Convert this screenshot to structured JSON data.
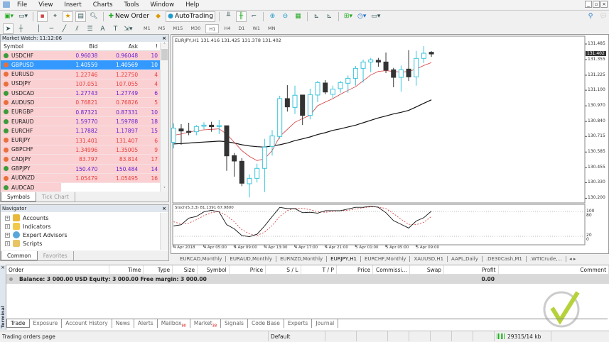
{
  "menu": [
    "File",
    "View",
    "Insert",
    "Charts",
    "Tools",
    "Window",
    "Help"
  ],
  "toolbar": {
    "new_order": "New Order",
    "autotrading": "AutoTrading",
    "timeframes": [
      "M1",
      "M5",
      "M15",
      "M30",
      "H1",
      "H4",
      "D1",
      "W1",
      "MN"
    ],
    "active_tf": "H1"
  },
  "market_watch": {
    "title": "Market Watch: 11:12:06",
    "columns": [
      "Symbol",
      "Bid",
      "Ask",
      "!"
    ],
    "rows": [
      {
        "symbol": "USDCHF",
        "bid": "0.96038",
        "ask": "0.96048",
        "spread": "10",
        "dir": "up"
      },
      {
        "symbol": "GBPUSD",
        "bid": "1.40559",
        "ask": "1.40569",
        "spread": "10",
        "dir": "down",
        "selected": true
      },
      {
        "symbol": "EURUSD",
        "bid": "1.22746",
        "ask": "1.22750",
        "spread": "4",
        "dir": "down"
      },
      {
        "symbol": "USDJPY",
        "bid": "107.051",
        "ask": "107.055",
        "spread": "4",
        "dir": "down"
      },
      {
        "symbol": "USDCAD",
        "bid": "1.27743",
        "ask": "1.27749",
        "spread": "6",
        "dir": "up"
      },
      {
        "symbol": "AUDUSD",
        "bid": "0.76821",
        "ask": "0.76826",
        "spread": "5",
        "dir": "down"
      },
      {
        "symbol": "EURGBP",
        "bid": "0.87321",
        "ask": "0.87331",
        "spread": "10",
        "dir": "up"
      },
      {
        "symbol": "EURAUD",
        "bid": "1.59770",
        "ask": "1.59788",
        "spread": "18",
        "dir": "up"
      },
      {
        "symbol": "EURCHF",
        "bid": "1.17882",
        "ask": "1.17897",
        "spread": "15",
        "dir": "up"
      },
      {
        "symbol": "EURJPY",
        "bid": "131.401",
        "ask": "131.407",
        "spread": "6",
        "dir": "down"
      },
      {
        "symbol": "GBPCHF",
        "bid": "1.34996",
        "ask": "1.35005",
        "spread": "9",
        "dir": "down"
      },
      {
        "symbol": "CADJPY",
        "bid": "83.797",
        "ask": "83.814",
        "spread": "17",
        "dir": "down"
      },
      {
        "symbol": "GBPJPY",
        "bid": "150.470",
        "ask": "150.484",
        "spread": "14",
        "dir": "up"
      },
      {
        "symbol": "AUDNZD",
        "bid": "1.05479",
        "ask": "1.05495",
        "spread": "16",
        "dir": "down"
      },
      {
        "symbol": "AUDCAD",
        "bid": "",
        "ask": "",
        "spread": "",
        "dir": "up"
      }
    ],
    "tabs": [
      "Symbols",
      "Tick Chart"
    ]
  },
  "navigator": {
    "title": "Navigator",
    "items": [
      "Accounts",
      "Indicators",
      "Expert Advisors",
      "Scripts"
    ],
    "tabs": [
      "Common",
      "Favorites"
    ]
  },
  "colors": {
    "up_text": "#6a1fd0",
    "down_text": "#e8403c",
    "bull": "#39c4dc",
    "bear": "#333333",
    "ma_fast": "#d43a3a",
    "ma_slow": "#111111",
    "selected": "#3399ff"
  },
  "chart_data": {
    "type": "candlestick",
    "title": "EURJPY,H1  131.416 131.425 131.378 131.402",
    "current_price": "131.402",
    "y_ticks": [
      "131.485",
      "131.355",
      "131.225",
      "131.100",
      "130.970",
      "130.840",
      "130.715",
      "130.585",
      "130.455",
      "130.330",
      "130.200"
    ],
    "ylim": [
      130.2,
      131.485
    ],
    "candles": [
      [
        130.666,
        130.784,
        130.823,
        130.616
      ],
      [
        130.778,
        130.76,
        130.817,
        130.646
      ],
      [
        130.758,
        130.752,
        130.829,
        130.725
      ],
      [
        130.754,
        130.798,
        130.809,
        130.725
      ],
      [
        130.8,
        130.809,
        130.833,
        130.774
      ],
      [
        130.809,
        130.796,
        130.837,
        130.754
      ],
      [
        130.798,
        130.806,
        130.853,
        130.735
      ],
      [
        130.804,
        130.553,
        130.804,
        130.429
      ],
      [
        130.555,
        130.51,
        130.577,
        130.38
      ],
      [
        130.508,
        130.325,
        130.534,
        130.301
      ],
      [
        130.321,
        130.366,
        130.4,
        130.207
      ],
      [
        130.366,
        130.449,
        130.488,
        130.331
      ],
      [
        130.449,
        130.626,
        130.695,
        130.252
      ],
      [
        130.632,
        130.719,
        130.768,
        130.555
      ],
      [
        130.715,
        131.03,
        131.054,
        130.695
      ],
      [
        131.03,
        130.961,
        131.142,
        130.922
      ],
      [
        130.957,
        131.058,
        131.138,
        130.902
      ],
      [
        131.06,
        130.89,
        131.06,
        130.81
      ],
      [
        130.89,
        131.064,
        131.113,
        130.857
      ],
      [
        131.06,
        131.164,
        131.178,
        131.001
      ],
      [
        131.16,
        131.085,
        131.184,
        131.066
      ],
      [
        131.066,
        131.109,
        131.138,
        131.034
      ],
      [
        131.113,
        131.164,
        131.178,
        131.079
      ],
      [
        131.158,
        131.199,
        131.223,
        131.079
      ],
      [
        131.199,
        131.282,
        131.302,
        131.138
      ],
      [
        131.282,
        131.335,
        131.355,
        131.164
      ],
      [
        131.335,
        131.353,
        131.369,
        131.251
      ],
      [
        131.349,
        131.334,
        131.369,
        131.296
      ],
      [
        131.335,
        131.267,
        131.414,
        131.243
      ],
      [
        131.27,
        131.207,
        131.286,
        131.125
      ],
      [
        131.207,
        131.27,
        131.306,
        131.089
      ],
      [
        131.276,
        131.211,
        131.434,
        131.178
      ],
      [
        131.211,
        131.365,
        131.428,
        131.138
      ],
      [
        131.365,
        131.408,
        131.467,
        131.326
      ],
      [
        131.416,
        131.402,
        131.425,
        131.378
      ]
    ],
    "ma_fast": [
      130.725,
      130.735,
      130.75,
      130.764,
      130.77,
      130.774,
      130.778,
      130.735,
      130.666,
      130.597,
      130.548,
      130.514,
      130.528,
      130.597,
      130.715,
      130.774,
      130.833,
      130.863,
      130.892,
      130.971,
      131.001,
      131.03,
      131.066,
      131.099,
      131.129,
      131.178,
      131.227,
      131.257,
      131.263,
      131.257,
      131.251,
      131.257,
      131.276,
      131.306,
      131.33
    ],
    "ma_slow": [
      130.652,
      130.656,
      130.66,
      130.664,
      130.668,
      130.672,
      130.676,
      130.672,
      130.66,
      130.646,
      130.636,
      130.63,
      130.626,
      130.636,
      130.646,
      130.66,
      130.68,
      130.695,
      130.711,
      130.731,
      130.746,
      130.766,
      130.778,
      130.794,
      130.809,
      130.829,
      130.849,
      130.869,
      130.886,
      130.902,
      130.916,
      130.932,
      130.961,
      130.991,
      131.02
    ],
    "stoch": {
      "label": "Stoch(5,3,3) 81.1391 67.9800",
      "levels_labels": [
        "100",
        "80",
        "20",
        "0"
      ],
      "main": [
        45,
        48,
        64,
        68,
        79,
        83,
        79,
        48,
        38,
        22,
        19,
        25,
        45,
        68,
        90,
        87,
        87,
        77,
        78,
        76,
        82,
        82,
        82,
        86,
        90,
        90,
        93,
        90,
        77,
        58,
        49,
        40,
        57,
        65,
        81
      ],
      "signal": [
        55,
        50,
        52,
        60,
        70,
        77,
        80,
        70,
        55,
        36,
        26,
        22,
        30,
        46,
        68,
        82,
        88,
        88,
        84,
        80,
        78,
        80,
        82,
        83,
        86,
        89,
        91,
        91,
        87,
        75,
        61,
        49,
        48,
        54,
        68
      ]
    },
    "x_ticks": [
      "4 Apr 2018",
      "4 Apr 05:00",
      "4 Apr 09:00",
      "4 Apr 13:00",
      "4 Apr 17:00",
      "4 Apr 21:00",
      "5 Apr 01:00",
      "5 Apr 05:00",
      "5 Apr 09:00"
    ]
  },
  "chart_tabs": [
    "EURCAD,Monthly",
    "EURAUD,Monthly",
    "EURNZD,Monthly",
    "EURJPY,H1",
    "EURCHF,Monthly",
    "XAUUSD,H1",
    "AAPL,Daily",
    ".DE30Cash,M1",
    ".WTICrude,..."
  ],
  "terminal": {
    "side_label": "Terminal",
    "columns": [
      "Order",
      "Time",
      "Type",
      "Size",
      "Symbol",
      "Price",
      "S / L",
      "T / P",
      "Price",
      "Commissi...",
      "Swap",
      "Profit",
      "Comment"
    ],
    "balance": "Balance: 3 000.00 USD  Equity: 3 000.00  Free margin: 3 000.00",
    "profit": "0.00",
    "tabs": [
      {
        "label": "Trade"
      },
      {
        "label": "Exposure"
      },
      {
        "label": "Account History"
      },
      {
        "label": "News"
      },
      {
        "label": "Alerts"
      },
      {
        "label": "Mailbox",
        "badge": "90"
      },
      {
        "label": "Market",
        "badge": "38"
      },
      {
        "label": "Signals"
      },
      {
        "label": "Code Base"
      },
      {
        "label": "Experts"
      },
      {
        "label": "Journal"
      }
    ]
  },
  "status": {
    "left": "Trading orders page",
    "profile": "Default",
    "traffic": "29315/14 kb"
  }
}
